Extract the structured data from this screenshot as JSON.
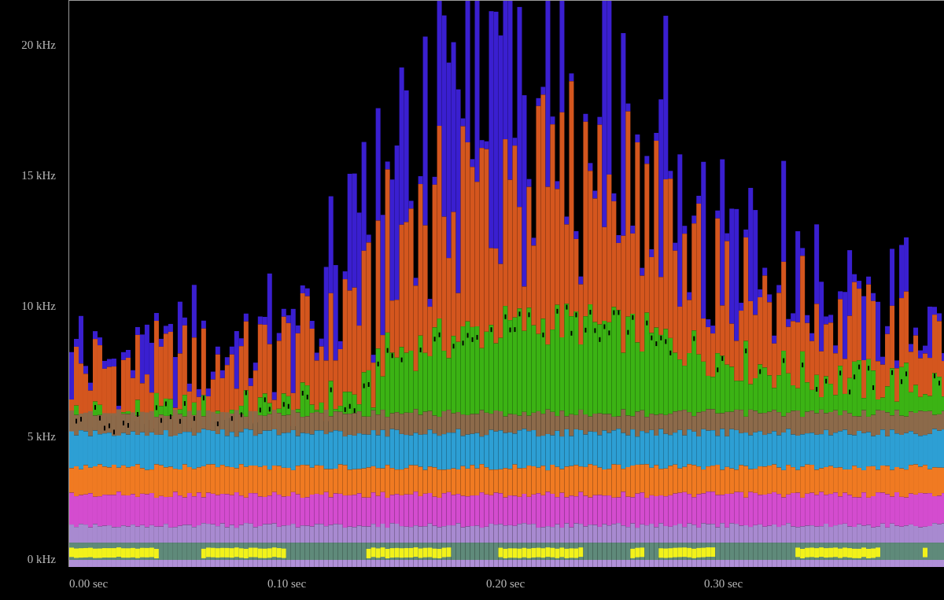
{
  "spectrogram": {
    "y_axis": {
      "ticks": [
        "20 kHz",
        "15 kHz",
        "10 kHz",
        "5 kHz",
        "0 kHz"
      ]
    },
    "x_axis": {
      "ticks": [
        "0.00 sec",
        "0.10 sec",
        "0.20 sec",
        "0.30 sec"
      ]
    }
  }
}
